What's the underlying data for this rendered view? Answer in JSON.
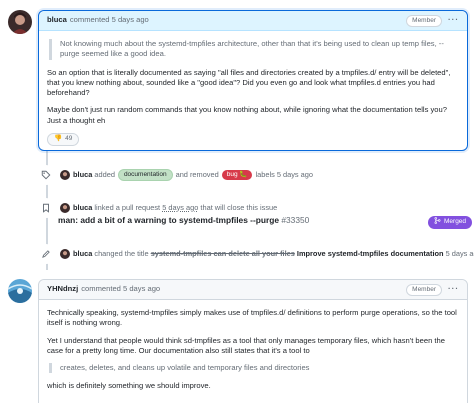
{
  "comment1": {
    "author": "bluca",
    "meta": "commented 5 days ago",
    "role": "Member",
    "quote": "Not knowing much about the systemd-tmpfiles architecture, other than that it's being used to clean up temp files, --purge seemed like a good idea.",
    "para1": "So an option that is literally documented as saying \"all files and directories created by a tmpfiles.d/ entry will be deleted\", that you knew nothing about, sounded like a \"good idea\"? Did you even go and look what tmpfiles.d entries you had beforehand?",
    "para2": "Maybe don't just run random commands that you know nothing about, while ignoring what the documentation tells you? Just a thought eh",
    "reaction_emoji": "👎",
    "reaction_count": "49"
  },
  "event_label": {
    "author": "bluca",
    "added": "added",
    "added_label": "documentation",
    "and_removed": "and removed",
    "removed_label": "bug",
    "removed_label_icon": "🐛",
    "tail": "labels 5 days ago"
  },
  "event_link": {
    "author": "bluca",
    "text": "linked a pull request",
    "time": "5 days ago",
    "tail": "that will close this issue",
    "pr_title": "man: add a bit of a warning to systemd-tmpfiles --purge",
    "pr_number": "#33350",
    "status": "Merged"
  },
  "event_rename": {
    "author": "bluca",
    "text": "changed the title",
    "old_title": "systemd-tmpfiles can delete all your files",
    "new_title": "Improve systemd-tmpfiles documentation",
    "time": "5 days ago"
  },
  "comment2": {
    "author": "YHNdnzj",
    "meta": "commented 5 days ago",
    "role": "Member",
    "para1": "Technically speaking, systemd-tmpfiles simply makes use of tmpfiles.d/ definitions to perform purge operations, so the tool itself is nothing wrong.",
    "para2": "Yet I understand that people would think sd-tmpfiles as a tool that only manages temporary files, which hasn't been the case for a pretty long time. Our documentation also still states that it's a tool to",
    "quote": "creates, deletes, and cleans up volatile and temporary files and directories",
    "para3": "which is definitely something we should improve."
  },
  "colors": {
    "accent": "#0969da",
    "merged": "#8250df",
    "bug": "#d73a4a",
    "documentation": "#c2e0c6"
  }
}
